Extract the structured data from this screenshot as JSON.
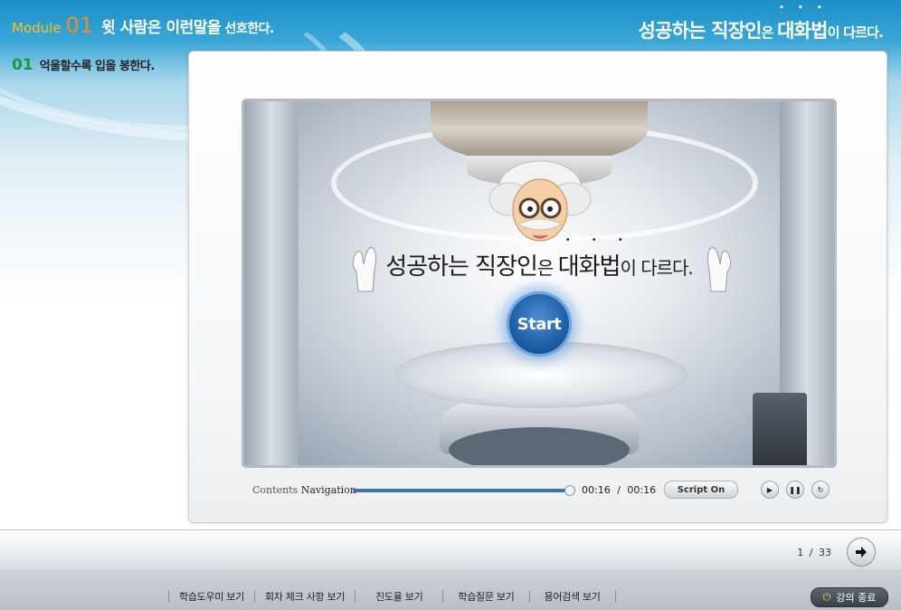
{
  "header": {
    "module_word": "Module",
    "module_number": "01",
    "module_title_main": "윗 사람은 이런말을",
    "module_title_tail": " 선호한다.",
    "course_title_a": "성공하는 직장인",
    "course_title_b": "은 ",
    "course_title_c": "대화법",
    "course_title_d": "이 다르다."
  },
  "lesson": {
    "number": "01",
    "title": "억울할수록 입을 봉한다."
  },
  "stage": {
    "title_a": "성공하는 직장인",
    "title_b": "은 ",
    "title_c": "대화법",
    "title_d": "이 다르다.",
    "start_label": "Start"
  },
  "player": {
    "nav_label_a": "Contents",
    "nav_label_b": "Navigation",
    "progress": 1.0,
    "current_time": "00:16",
    "total_time": "00:16",
    "time_sep": "/",
    "script_button": "Script On"
  },
  "pagination": {
    "current": "1",
    "sep": "/",
    "total": "33"
  },
  "footer": {
    "menu": [
      "학습도우미 보기",
      "회차 체크 사항 보기",
      "진도율 보기",
      "학습질문 보기",
      "용어검색 보기"
    ],
    "exit_label": "강의 종료"
  },
  "colors": {
    "accent_blue": "#1f5fa8",
    "module_number": "#f08a2a",
    "module_word": "#f5c51b",
    "lesson_number": "#1a9a3a"
  },
  "icons": [
    "play-icon",
    "pause-icon",
    "replay-icon",
    "arrow-right-icon",
    "power-icon"
  ]
}
